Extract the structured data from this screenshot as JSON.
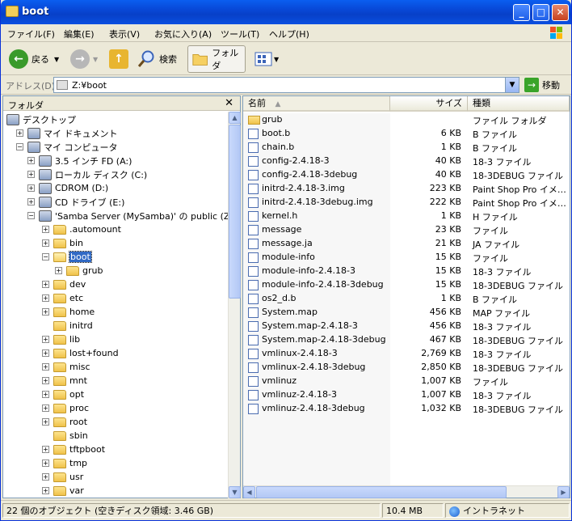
{
  "window": {
    "title": "boot",
    "controls": {
      "minimize": "_",
      "maximize": "□",
      "close": "✕"
    }
  },
  "menu": [
    "ファイル(F)",
    "編集(E)",
    "表示(V)",
    "お気に入り(A)",
    "ツール(T)",
    "ヘルプ(H)"
  ],
  "toolbar": {
    "back_label": "戻る",
    "search_label": "検索",
    "folders_label": "フォルダ"
  },
  "address": {
    "label": "アドレス(D)",
    "value": "Z:¥boot",
    "go_label": "移動"
  },
  "folder_pane": {
    "title": "フォルダ",
    "tree": [
      {
        "label": "デスクトップ",
        "icon": "desktop-icon",
        "expander": ""
      },
      {
        "label": "マイ ドキュメント",
        "icon": "my-documents-icon",
        "expander": "+"
      },
      {
        "label": "マイ コンピュータ",
        "icon": "my-computer-icon",
        "expander": "−"
      },
      {
        "label": "3.5 インチ FD (A:)",
        "icon": "floppy-icon",
        "expander": "+"
      },
      {
        "label": "ローカル ディスク (C:)",
        "icon": "hard-disk-icon",
        "expander": "+"
      },
      {
        "label": "CDROM (D:)",
        "icon": "cdrom-icon",
        "expander": "+"
      },
      {
        "label": "CD ドライブ (E:)",
        "icon": "cd-drive-icon",
        "expander": "+"
      },
      {
        "label": "'Samba Server (MySamba)' の public (Z:)",
        "icon": "network-drive-icon",
        "expander": "−"
      },
      {
        "label": ".automount",
        "icon": "folder-icon",
        "expander": "+"
      },
      {
        "label": "bin",
        "icon": "folder-icon",
        "expander": "+"
      },
      {
        "label": "boot",
        "icon": "folder-open-icon",
        "expander": "−",
        "selected": true
      },
      {
        "label": "grub",
        "icon": "folder-icon",
        "expander": "+"
      },
      {
        "label": "dev",
        "icon": "folder-icon",
        "expander": "+"
      },
      {
        "label": "etc",
        "icon": "folder-icon",
        "expander": "+"
      },
      {
        "label": "home",
        "icon": "folder-icon",
        "expander": "+"
      },
      {
        "label": "initrd",
        "icon": "folder-icon",
        "expander": ""
      },
      {
        "label": "lib",
        "icon": "folder-icon",
        "expander": "+"
      },
      {
        "label": "lost+found",
        "icon": "folder-icon",
        "expander": "+"
      },
      {
        "label": "misc",
        "icon": "folder-icon",
        "expander": "+"
      },
      {
        "label": "mnt",
        "icon": "folder-icon",
        "expander": "+"
      },
      {
        "label": "opt",
        "icon": "folder-icon",
        "expander": "+"
      },
      {
        "label": "proc",
        "icon": "folder-icon",
        "expander": "+"
      },
      {
        "label": "root",
        "icon": "folder-icon",
        "expander": "+"
      },
      {
        "label": "sbin",
        "icon": "folder-icon",
        "expander": ""
      },
      {
        "label": "tftpboot",
        "icon": "folder-icon",
        "expander": "+"
      },
      {
        "label": "tmp",
        "icon": "folder-icon",
        "expander": "+"
      },
      {
        "label": "usr",
        "icon": "folder-icon",
        "expander": "+"
      },
      {
        "label": "var",
        "icon": "folder-icon",
        "expander": "+"
      }
    ]
  },
  "file_list": {
    "columns": {
      "name": "名前",
      "size": "サイズ",
      "type": "種類"
    },
    "files": [
      {
        "name": "grub",
        "size": "",
        "type": "ファイル フォルダ",
        "icon": "folder-icon"
      },
      {
        "name": "boot.b",
        "size": "6 KB",
        "type": "B ファイル",
        "icon": "file-icon"
      },
      {
        "name": "chain.b",
        "size": "1 KB",
        "type": "B ファイル",
        "icon": "file-icon"
      },
      {
        "name": "config-2.4.18-3",
        "size": "40 KB",
        "type": "18-3 ファイル",
        "icon": "file-icon"
      },
      {
        "name": "config-2.4.18-3debug",
        "size": "40 KB",
        "type": "18-3DEBUG ファイル",
        "icon": "file-icon"
      },
      {
        "name": "initrd-2.4.18-3.img",
        "size": "223 KB",
        "type": "Paint Shop Pro イメ…",
        "icon": "image-file-icon"
      },
      {
        "name": "initrd-2.4.18-3debug.img",
        "size": "222 KB",
        "type": "Paint Shop Pro イメ…",
        "icon": "image-file-icon"
      },
      {
        "name": "kernel.h",
        "size": "1 KB",
        "type": "H ファイル",
        "icon": "text-file-icon"
      },
      {
        "name": "message",
        "size": "23 KB",
        "type": "ファイル",
        "icon": "file-icon"
      },
      {
        "name": "message.ja",
        "size": "21 KB",
        "type": "JA ファイル",
        "icon": "file-icon"
      },
      {
        "name": "module-info",
        "size": "15 KB",
        "type": "ファイル",
        "icon": "file-icon"
      },
      {
        "name": "module-info-2.4.18-3",
        "size": "15 KB",
        "type": "18-3 ファイル",
        "icon": "file-icon"
      },
      {
        "name": "module-info-2.4.18-3debug",
        "size": "15 KB",
        "type": "18-3DEBUG ファイル",
        "icon": "file-icon"
      },
      {
        "name": "os2_d.b",
        "size": "1 KB",
        "type": "B ファイル",
        "icon": "file-icon"
      },
      {
        "name": "System.map",
        "size": "456 KB",
        "type": "MAP ファイル",
        "icon": "file-icon"
      },
      {
        "name": "System.map-2.4.18-3",
        "size": "456 KB",
        "type": "18-3 ファイル",
        "icon": "file-icon"
      },
      {
        "name": "System.map-2.4.18-3debug",
        "size": "467 KB",
        "type": "18-3DEBUG ファイル",
        "icon": "file-icon"
      },
      {
        "name": "vmlinux-2.4.18-3",
        "size": "2,769 KB",
        "type": "18-3 ファイル",
        "icon": "file-icon"
      },
      {
        "name": "vmlinux-2.4.18-3debug",
        "size": "2,850 KB",
        "type": "18-3DEBUG ファイル",
        "icon": "file-icon"
      },
      {
        "name": "vmlinuz",
        "size": "1,007 KB",
        "type": "ファイル",
        "icon": "file-icon"
      },
      {
        "name": "vmlinuz-2.4.18-3",
        "size": "1,007 KB",
        "type": "18-3 ファイル",
        "icon": "file-icon"
      },
      {
        "name": "vmlinuz-2.4.18-3debug",
        "size": "1,032 KB",
        "type": "18-3DEBUG ファイル",
        "icon": "file-icon"
      }
    ]
  },
  "status": {
    "objects": "22 個のオブジェクト (空きディスク領域: 3.46 GB)",
    "size": "10.4 MB",
    "zone": "イントラネット"
  },
  "colors": {
    "titlebar": "#0a5ef0",
    "selection": "#316ac5",
    "window_bg": "#ece9d8"
  }
}
